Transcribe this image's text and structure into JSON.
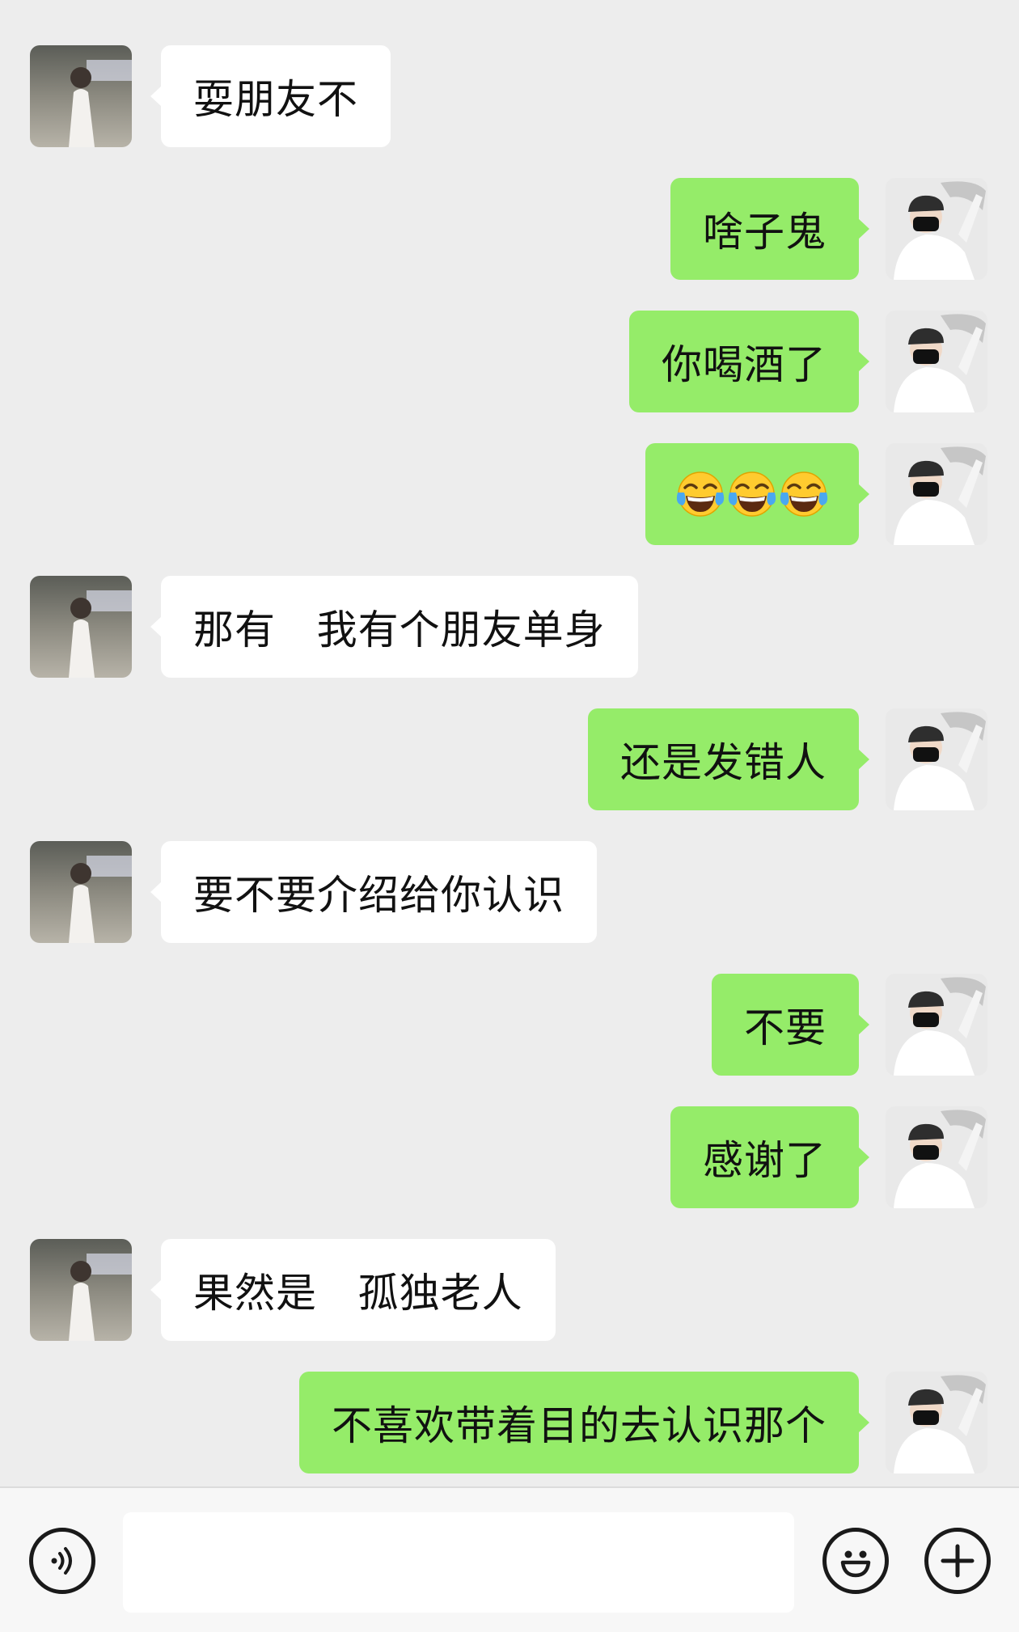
{
  "messages": [
    {
      "side": "left",
      "text": "耍朋友不"
    },
    {
      "side": "right",
      "text": "啥子鬼"
    },
    {
      "side": "right",
      "text": "你喝酒了"
    },
    {
      "side": "right",
      "text": "",
      "emoji": [
        "face-with-tears-of-joy",
        "face-with-tears-of-joy",
        "face-with-tears-of-joy"
      ]
    },
    {
      "side": "left",
      "text": "那有   我有个朋友单身"
    },
    {
      "side": "right",
      "text": "还是发错人"
    },
    {
      "side": "left",
      "text": "要不要介绍给你认识"
    },
    {
      "side": "right",
      "text": "不要"
    },
    {
      "side": "right",
      "text": "感谢了"
    },
    {
      "side": "left",
      "text": "果然是   孤独老人"
    },
    {
      "side": "right",
      "text": "不喜欢带着目的去认识那个"
    }
  ],
  "colors": {
    "background": "#ededed",
    "incoming_bubble": "#ffffff",
    "outgoing_bubble": "#95ec69",
    "text": "#111111"
  },
  "input_bar": {
    "voice_icon": "voice-icon",
    "emoji_icon": "smiley-icon",
    "plus_icon": "plus-icon",
    "value": ""
  }
}
